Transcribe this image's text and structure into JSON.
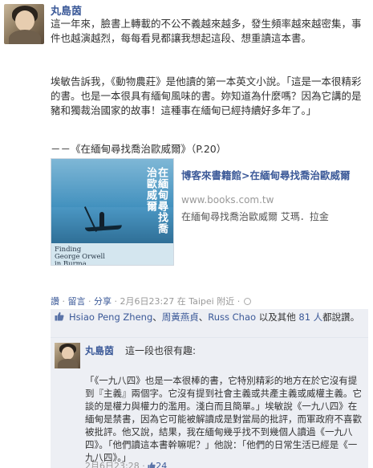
{
  "post": {
    "author": "丸島茵",
    "paragraph1": "這一年來，臉書上轉載的不公不義越來越多，發生頻率越來越密集，事件也越演越烈，每每看見都讓我想起這段、想重讀這本書。",
    "paragraph2": "埃敏告訴我，《動物農莊》是他讀的第一本英文小說。「這是一本很精彩的書。也是一本很具有緬甸風味的書。妳知道為什麼嗎？因為它講的是豬和獨裁治國家的故事！這種事在緬甸已經持續好多年了。」",
    "quote_source": "－－《在緬甸尋找喬治歐威爾》（P.20）",
    "share": {
      "title": "博客來書籍館>在緬甸尋找喬治歐威爾",
      "url": "www.books.com.tw",
      "description": "在緬甸尋找喬治歐威爾 艾瑪．拉金",
      "cover_title_vertical": "在緬甸尋找喬治歐威爾",
      "cover_english": "Finding\nGeorge Orwell\nin Burma"
    },
    "meta": {
      "like": "讚",
      "sep1": " · ",
      "comment": "留言",
      "sep2": " · ",
      "share": "分享",
      "sep3": " · ",
      "time": "2月6日23:27",
      "location": "在 Taipei 附近",
      "sep4": " · "
    }
  },
  "likes": {
    "name1": "Hsiao Peng Zheng",
    "comma1": "、",
    "name2": "周黃燕貞",
    "comma2": "、",
    "name3": "Russ Chao",
    "and_text": " 以及其他 ",
    "others": "81 人",
    "suffix": "都說讚。"
  },
  "comment": {
    "author": "丸島茵",
    "intro": "這一段也很有趣:",
    "text": "「《一九八四》也是一本很棒的書，它特別精彩的地方在於它沒有提到『主義』兩個字。它沒有提到社會主義或共產主義或威權主義。它談的是權力與權力的濫用。淺白而且簡單。」埃敏說《一九八四》在緬甸是禁書，因為它可能被解讀成是對當局的批評，而軍政府不喜歡被批評。他又說，結果，我在緬甸幾乎找不到幾個人讀過《一九八四》。「他們讀這本書幹嘛呢？」他說：「他們的日常生活已經是《一九八四》。」",
    "time": "2月6日23:28",
    "sep": " · ",
    "like_count": "24"
  },
  "colors": {
    "link": "#3b5998",
    "meta": "#999999",
    "ufi_bg": "#edeff4"
  }
}
